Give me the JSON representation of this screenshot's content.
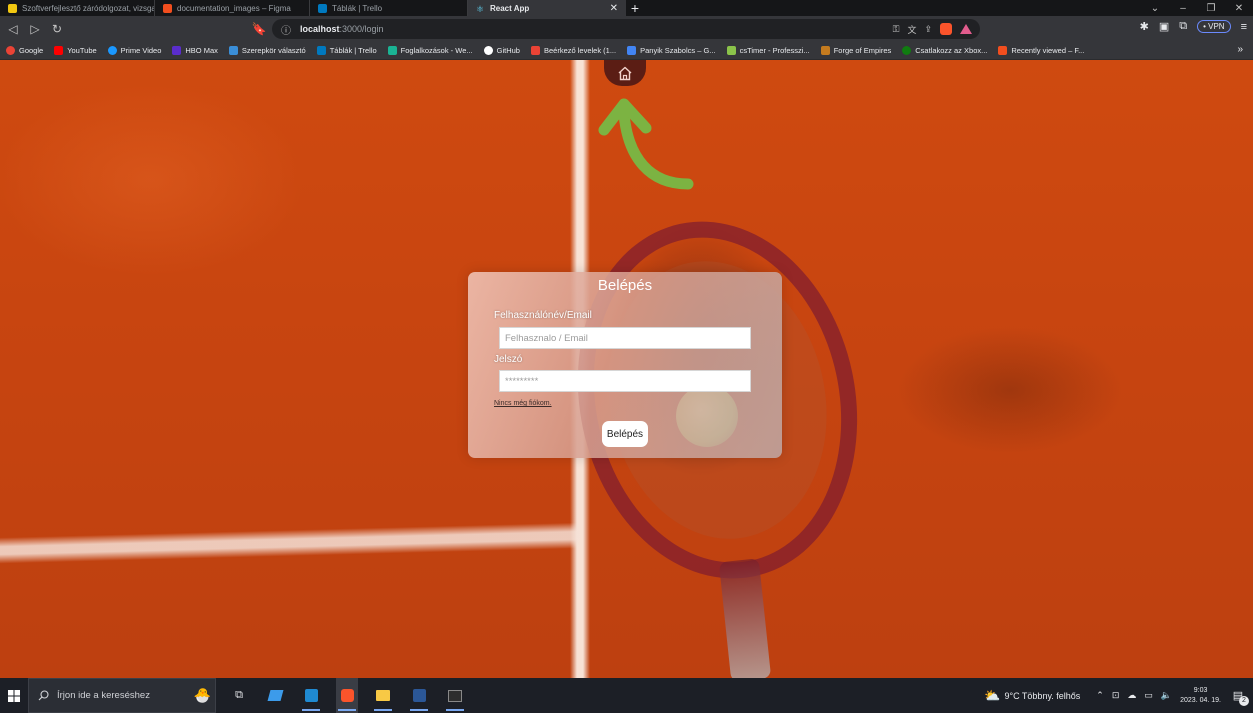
{
  "browser": {
    "tabs": [
      {
        "title": "Szoftverfejlesztő záródolgozat, vizsga",
        "color": "#f2c811"
      },
      {
        "title": "documentation_images – Figma",
        "color": "#f24e1e"
      },
      {
        "title": "Táblák | Trello",
        "color": "#0079bf"
      },
      {
        "title": "React App",
        "color": "#61dafb"
      }
    ],
    "new_tab_label": "+",
    "url_host": "localhost",
    "url_path": ":3000/login",
    "vpn_label": "• VPN"
  },
  "bookmarks": [
    {
      "label": "Google",
      "color": "#ea4335"
    },
    {
      "label": "YouTube",
      "color": "#ff0000"
    },
    {
      "label": "Prime Video",
      "color": "#1a98ff"
    },
    {
      "label": "HBO Max",
      "color": "#5a2dcc"
    },
    {
      "label": "Szerepkör választó",
      "color": "#3a8ed8"
    },
    {
      "label": "Táblák | Trello",
      "color": "#0079bf"
    },
    {
      "label": "Foglalkozások - We...",
      "color": "#1ab394"
    },
    {
      "label": "GitHub",
      "color": "#ffffff"
    },
    {
      "label": "Beérkező levelek (1...",
      "color": "#ea4335"
    },
    {
      "label": "Panyik Szabolcs – G...",
      "color": "#4285f4"
    },
    {
      "label": "csTimer - Professzi...",
      "color": "#8bc34a"
    },
    {
      "label": "Forge of Empires",
      "color": "#c47b1f"
    },
    {
      "label": "Csatlakozz az Xbox...",
      "color": "#107c10"
    },
    {
      "label": "Recently viewed – F...",
      "color": "#f24e1e"
    }
  ],
  "login": {
    "title": "Belépés",
    "username_label": "Felhasználónév/Email",
    "username_placeholder": "Felhasznalo / Email",
    "password_label": "Jelszó",
    "password_value": "*********",
    "register_link": "Nincs még fiókom.",
    "submit_label": "Belépés"
  },
  "taskbar": {
    "search_placeholder": "Írjon ide a kereséshez",
    "weather": "9°C  Többny. felhős",
    "time": "9:03",
    "date": "2023. 04. 19.",
    "notifications": "2"
  },
  "colors": {
    "accent_arrow": "#7cb342",
    "home_button": "#5b1d14",
    "court_orange": "#c84510"
  }
}
